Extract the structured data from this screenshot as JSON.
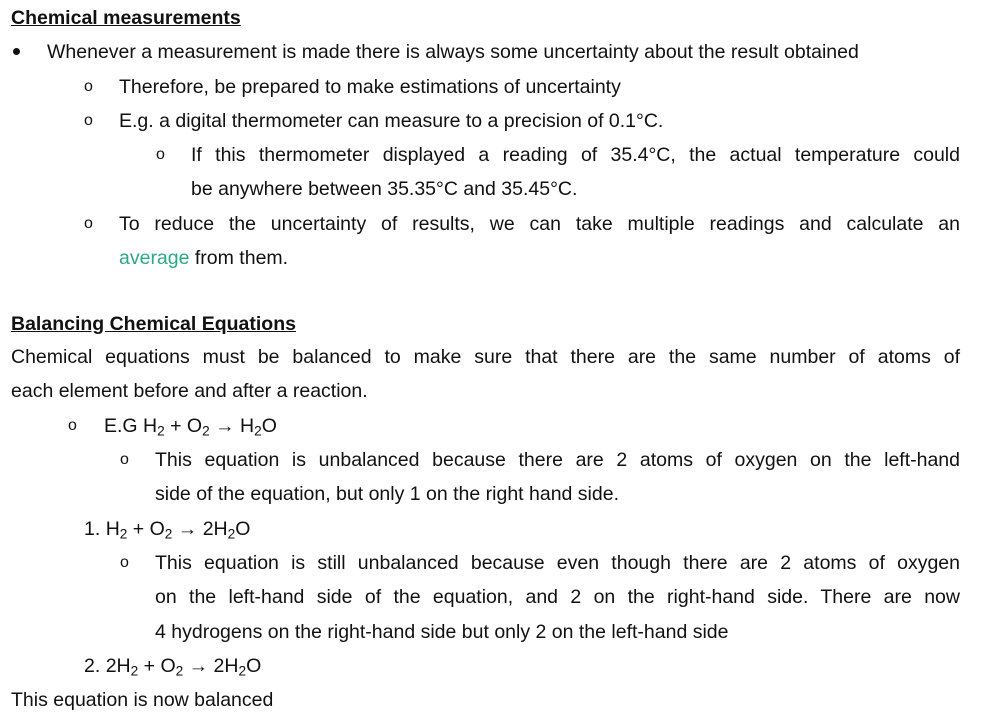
{
  "section1": {
    "title": "Chemical measurements",
    "bullet1": "Whenever a measurement is made there is always some uncertainty about the result obtained",
    "sub1": "Therefore, be prepared to make estimations of uncertainty",
    "sub2": "E.g. a digital thermometer can measure to a precision of 0.1°C.",
    "subsub1_line1": "If this thermometer displayed a reading of 35.4°C, the actual temperature could",
    "subsub1_line2": "be anywhere between 35.35°C and 35.45°C.",
    "sub3_line1": "To reduce the uncertainty of results, we can take multiple readings and calculate an",
    "sub3_accent": "average",
    "sub3_rest": " from them."
  },
  "section2": {
    "title": "Balancing Chemical Equations",
    "intro_line1": "Chemical equations must be balanced to make sure that there are the same number of atoms of",
    "intro_line2": "each element before and after a reaction.",
    "eg_prefix": "E.G ",
    "eq0": {
      "a": "H",
      "a_sub": "2",
      "plus": " + O",
      "b_sub": "2",
      "arrow": " → H",
      "c_sub": "2",
      "c_end": "O"
    },
    "eq0_note_line1": "This equation is unbalanced because there are 2 atoms of oxygen on the left-hand",
    "eq0_note_line2": "side of the equation, but only 1 on the right hand side.",
    "step1_num": "1. ",
    "eq1": {
      "a": "H",
      "a_sub": "2",
      "plus": " + O",
      "b_sub": "2",
      "arrow": " → 2H",
      "c_sub": "2",
      "c_end": "O"
    },
    "eq1_note_line1": "This equation is still unbalanced because even though there are 2 atoms of oxygen",
    "eq1_note_line2": "on the left-hand side of the equation, and 2 on the right-hand side. There are now",
    "eq1_note_line3": "4 hydrogens on the right-hand side but only 2 on the left-hand side",
    "step2_num": "2. ",
    "eq2": {
      "a": "2H",
      "a_sub": "2",
      "plus": " + O",
      "b_sub": "2",
      "arrow": " → 2H",
      "c_sub": "2",
      "c_end": "O"
    },
    "conclusion": "This equation is now balanced"
  }
}
